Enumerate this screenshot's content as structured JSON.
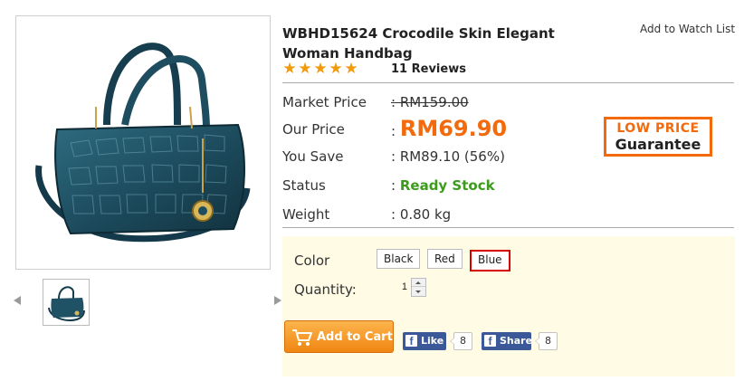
{
  "product": {
    "title": "WBHD15624 Crocodile Skin Elegant Woman Handbag",
    "watch_label": "Add to Watch List",
    "rating_stars": 5,
    "reviews_label": "11 Reviews"
  },
  "pricing": {
    "market_label": "Market Price",
    "market_value": ": RM159.00",
    "our_label": "Our Price",
    "colon": ":",
    "our_value": "RM69.90",
    "save_label": "You Save",
    "save_value": ": RM89.10 (56%)",
    "status_label": "Status",
    "status_value": "Ready Stock",
    "weight_label": "Weight",
    "weight_value": ": 0.80 kg"
  },
  "badge": {
    "line1": "LOW PRICE",
    "line2": "Guarantee"
  },
  "options": {
    "color_label": "Color",
    "colors": [
      "Black",
      "Red",
      "Blue"
    ],
    "selected_color": "Blue",
    "quantity_label": "Quantity:",
    "quantity_value": "1"
  },
  "actions": {
    "cart_label": "Add to Cart",
    "fb_like_label": "Like",
    "fb_like_count": "8",
    "fb_share_label": "Share",
    "fb_share_count": "8"
  },
  "icons": [
    "star-icon",
    "prev-arrow-icon",
    "next-arrow-icon",
    "cart-icon",
    "facebook-icon"
  ],
  "colors": {
    "accent_orange": "#f36a0d",
    "stock_green": "#3c9a1c",
    "selected_border": "#d40000",
    "options_bg": "#fffbe4",
    "facebook_blue": "#3b5998"
  }
}
